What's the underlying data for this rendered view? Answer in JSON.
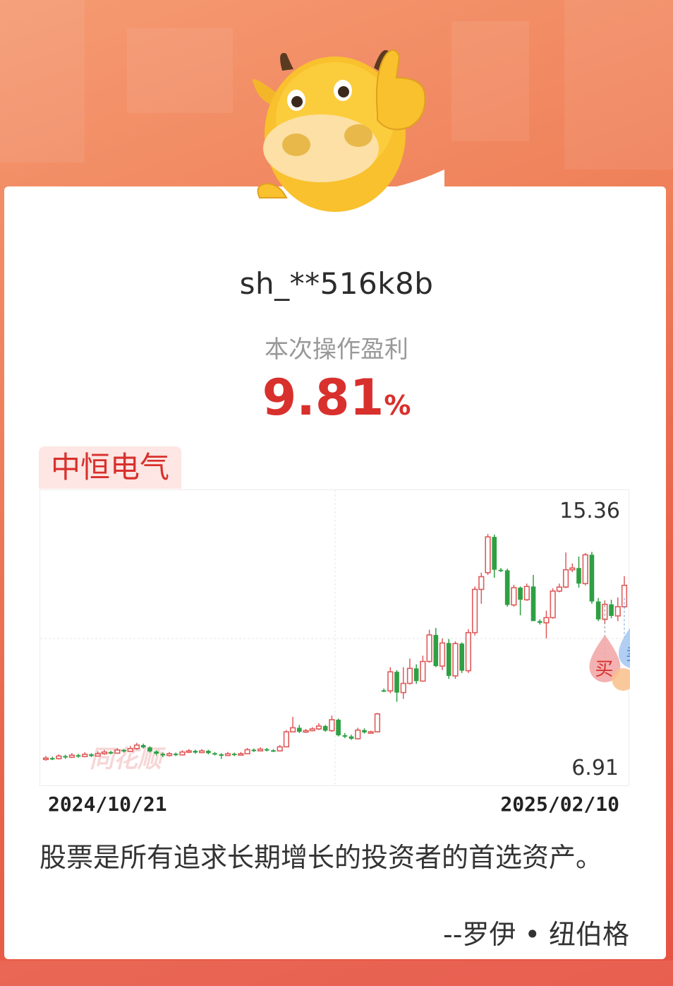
{
  "user": {
    "name": "sh_**516k8b"
  },
  "profit": {
    "label": "本次操作盈利",
    "value": "9.81",
    "unit": "%",
    "color": "#d8302d"
  },
  "stock": {
    "name": "中恒电气"
  },
  "chart": {
    "max_label": "15.36",
    "min_label": "6.91",
    "date_start": "2024/10/21",
    "date_end": "2025/02/10",
    "markers": {
      "buy": "买",
      "sell": "卖"
    },
    "watermark": "同花顺",
    "up_color": "#e05a5a",
    "down_color": "#2ea043"
  },
  "chart_data": {
    "type": "candlestick",
    "ylim": [
      6.91,
      15.36
    ],
    "x_labels": [
      "2024/10/21",
      "2025/02/10"
    ],
    "candles": [
      [
        7.0,
        7.05,
        7.12,
        6.96
      ],
      [
        7.05,
        7.03,
        7.1,
        6.98
      ],
      [
        7.03,
        7.12,
        7.18,
        7.0
      ],
      [
        7.12,
        7.08,
        7.16,
        7.02
      ],
      [
        7.08,
        7.15,
        7.22,
        7.05
      ],
      [
        7.15,
        7.1,
        7.2,
        7.06
      ],
      [
        7.1,
        7.18,
        7.25,
        7.08
      ],
      [
        7.18,
        7.12,
        7.22,
        7.08
      ],
      [
        7.12,
        7.2,
        7.28,
        7.1
      ],
      [
        7.2,
        7.26,
        7.33,
        7.16
      ],
      [
        7.26,
        7.22,
        7.3,
        7.18
      ],
      [
        7.22,
        7.33,
        7.4,
        7.2
      ],
      [
        7.33,
        7.28,
        7.36,
        7.24
      ],
      [
        7.28,
        7.38,
        7.47,
        7.26
      ],
      [
        7.38,
        7.5,
        7.58,
        7.34
      ],
      [
        7.5,
        7.42,
        7.55,
        7.38
      ],
      [
        7.42,
        7.28,
        7.46,
        7.24
      ],
      [
        7.28,
        7.2,
        7.32,
        7.14
      ],
      [
        7.2,
        7.14,
        7.24,
        7.08
      ],
      [
        7.14,
        7.2,
        7.26,
        7.1
      ],
      [
        7.2,
        7.16,
        7.24,
        7.12
      ],
      [
        7.16,
        7.26,
        7.32,
        7.14
      ],
      [
        7.26,
        7.3,
        7.36,
        7.22
      ],
      [
        7.3,
        7.24,
        7.34,
        7.2
      ],
      [
        7.24,
        7.3,
        7.36,
        7.22
      ],
      [
        7.3,
        7.22,
        7.34,
        7.18
      ],
      [
        7.22,
        7.18,
        7.26,
        7.14
      ],
      [
        7.18,
        7.14,
        7.22,
        7.02
      ],
      [
        7.14,
        7.2,
        7.26,
        7.12
      ],
      [
        7.2,
        7.16,
        7.24,
        7.12
      ],
      [
        7.16,
        7.2,
        7.26,
        7.14
      ],
      [
        7.2,
        7.34,
        7.4,
        7.18
      ],
      [
        7.34,
        7.3,
        7.38,
        7.26
      ],
      [
        7.3,
        7.36,
        7.42,
        7.28
      ],
      [
        7.36,
        7.32,
        7.4,
        7.28
      ],
      [
        7.32,
        7.3,
        7.36,
        7.26
      ],
      [
        7.3,
        7.44,
        7.5,
        7.28
      ],
      [
        7.44,
        7.96,
        8.02,
        7.42
      ],
      [
        7.96,
        8.1,
        8.48,
        7.94
      ],
      [
        8.1,
        7.96,
        8.2,
        7.92
      ],
      [
        7.96,
        8.0,
        8.06,
        7.92
      ],
      [
        8.0,
        8.06,
        8.12,
        7.98
      ],
      [
        8.06,
        8.16,
        8.26,
        8.02
      ],
      [
        8.16,
        8.0,
        8.2,
        7.96
      ],
      [
        8.0,
        8.38,
        8.52,
        7.96
      ],
      [
        8.38,
        7.84,
        8.42,
        7.8
      ],
      [
        7.84,
        7.8,
        7.92,
        7.74
      ],
      [
        7.8,
        7.72,
        7.86,
        7.68
      ],
      [
        7.72,
        8.02,
        8.1,
        7.7
      ],
      [
        8.02,
        7.94,
        8.08,
        7.9
      ],
      [
        7.94,
        7.96,
        8.0,
        7.9
      ],
      [
        7.96,
        8.58,
        8.62,
        7.94
      ],
      [
        9.4,
        9.38,
        9.46,
        9.34
      ],
      [
        9.38,
        10.04,
        10.2,
        9.3
      ],
      [
        10.04,
        9.32,
        10.1,
        9.0
      ],
      [
        9.32,
        9.64,
        10.2,
        9.1
      ],
      [
        9.64,
        10.16,
        10.5,
        9.6
      ],
      [
        10.16,
        9.72,
        10.3,
        9.62
      ],
      [
        9.72,
        10.4,
        10.6,
        9.7
      ],
      [
        10.4,
        11.32,
        11.5,
        10.36
      ],
      [
        11.32,
        10.24,
        11.56,
        10.2
      ],
      [
        10.24,
        11.04,
        11.2,
        10.1
      ],
      [
        11.04,
        9.9,
        11.18,
        9.8
      ],
      [
        9.9,
        11.02,
        11.1,
        9.8
      ],
      [
        11.02,
        10.08,
        11.06,
        10.0
      ],
      [
        10.08,
        11.4,
        11.52,
        10.0
      ],
      [
        11.4,
        12.9,
        13.0,
        11.3
      ],
      [
        12.9,
        13.34,
        13.48,
        12.4
      ],
      [
        13.48,
        14.72,
        14.82,
        13.4
      ],
      [
        14.72,
        13.58,
        14.8,
        13.3
      ],
      [
        13.58,
        13.56,
        13.64,
        13.5
      ],
      [
        13.56,
        12.36,
        13.62,
        12.3
      ],
      [
        12.36,
        12.96,
        13.06,
        12.3
      ],
      [
        12.96,
        12.54,
        13.0,
        12.0
      ],
      [
        12.54,
        13.0,
        13.1,
        12.5
      ],
      [
        13.0,
        11.8,
        13.4,
        11.8
      ],
      [
        11.8,
        11.74,
        11.86,
        11.68
      ],
      [
        11.74,
        11.92,
        12.16,
        11.2
      ],
      [
        11.92,
        12.84,
        12.94,
        11.88
      ],
      [
        12.84,
        12.98,
        13.1,
        12.8
      ],
      [
        12.98,
        13.58,
        14.18,
        12.94
      ],
      [
        13.58,
        13.64,
        13.8,
        13.5
      ],
      [
        13.64,
        13.1,
        14.04,
        12.96
      ],
      [
        13.1,
        14.1,
        14.16,
        13.04
      ],
      [
        14.1,
        12.48,
        14.2,
        12.4
      ],
      [
        12.48,
        11.86,
        12.6,
        11.8
      ],
      [
        11.86,
        12.38,
        12.52,
        11.7
      ],
      [
        12.38,
        11.98,
        12.54,
        11.9
      ],
      [
        11.98,
        12.3,
        12.62,
        11.8
      ],
      [
        12.3,
        13.04,
        13.36,
        12.24
      ]
    ]
  }
}
